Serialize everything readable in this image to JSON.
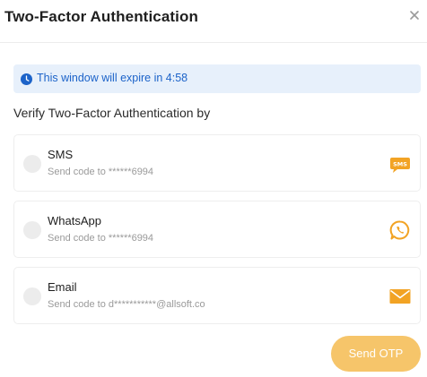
{
  "dialog": {
    "title": "Two-Factor Authentication",
    "close_icon": "close-icon"
  },
  "banner": {
    "icon": "clock-icon",
    "text": "This window will expire in 4:58",
    "color": "#1c63c9",
    "background": "#e7f0fb"
  },
  "subtitle": "Verify Two-Factor Authentication by",
  "options": [
    {
      "label": "SMS",
      "desc": "Send code to ******6994",
      "icon": "sms-icon",
      "selected": false
    },
    {
      "label": "WhatsApp",
      "desc": "Send code to ******6994",
      "icon": "whatsapp-icon",
      "selected": false
    },
    {
      "label": "Email",
      "desc": "Send code to d***********@allsoft.co",
      "icon": "email-icon",
      "selected": false
    }
  ],
  "actions": {
    "send_label": "Send OTP"
  },
  "colors": {
    "accent": "#f2a324",
    "button": "#f6c56a"
  }
}
